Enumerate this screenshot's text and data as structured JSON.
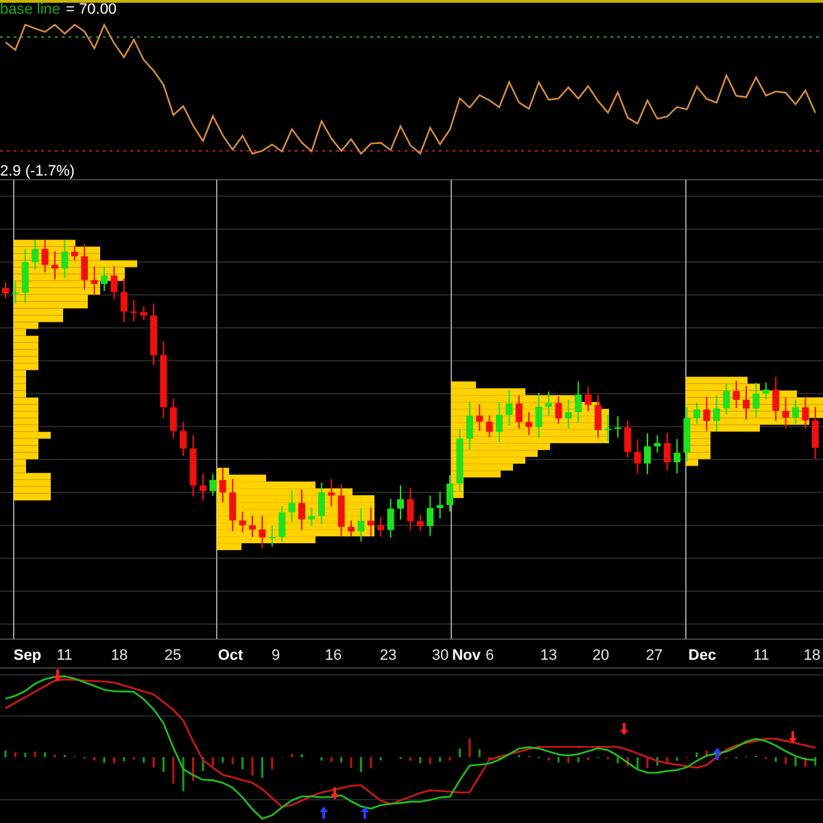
{
  "rsi_panel": {
    "legend_label": "base line",
    "legend_value": "= 70.00"
  },
  "price_panel": {
    "change_label": "2.9 (-1.7%)"
  },
  "x_axis": {
    "labels": [
      {
        "text": "Sep",
        "kind": "month"
      },
      {
        "text": "11",
        "kind": "day"
      },
      {
        "text": "18",
        "kind": "day"
      },
      {
        "text": "25",
        "kind": "day"
      },
      {
        "text": "Oct",
        "kind": "month"
      },
      {
        "text": "9",
        "kind": "day"
      },
      {
        "text": "16",
        "kind": "day"
      },
      {
        "text": "23",
        "kind": "day"
      },
      {
        "text": "30",
        "kind": "day"
      },
      {
        "text": "Nov",
        "kind": "month"
      },
      {
        "text": "6",
        "kind": "day"
      },
      {
        "text": "13",
        "kind": "day"
      },
      {
        "text": "20",
        "kind": "day"
      },
      {
        "text": "27",
        "kind": "day"
      },
      {
        "text": "Dec",
        "kind": "month"
      },
      {
        "text": "11",
        "kind": "day"
      },
      {
        "text": "18",
        "kind": "day"
      }
    ]
  }
}
